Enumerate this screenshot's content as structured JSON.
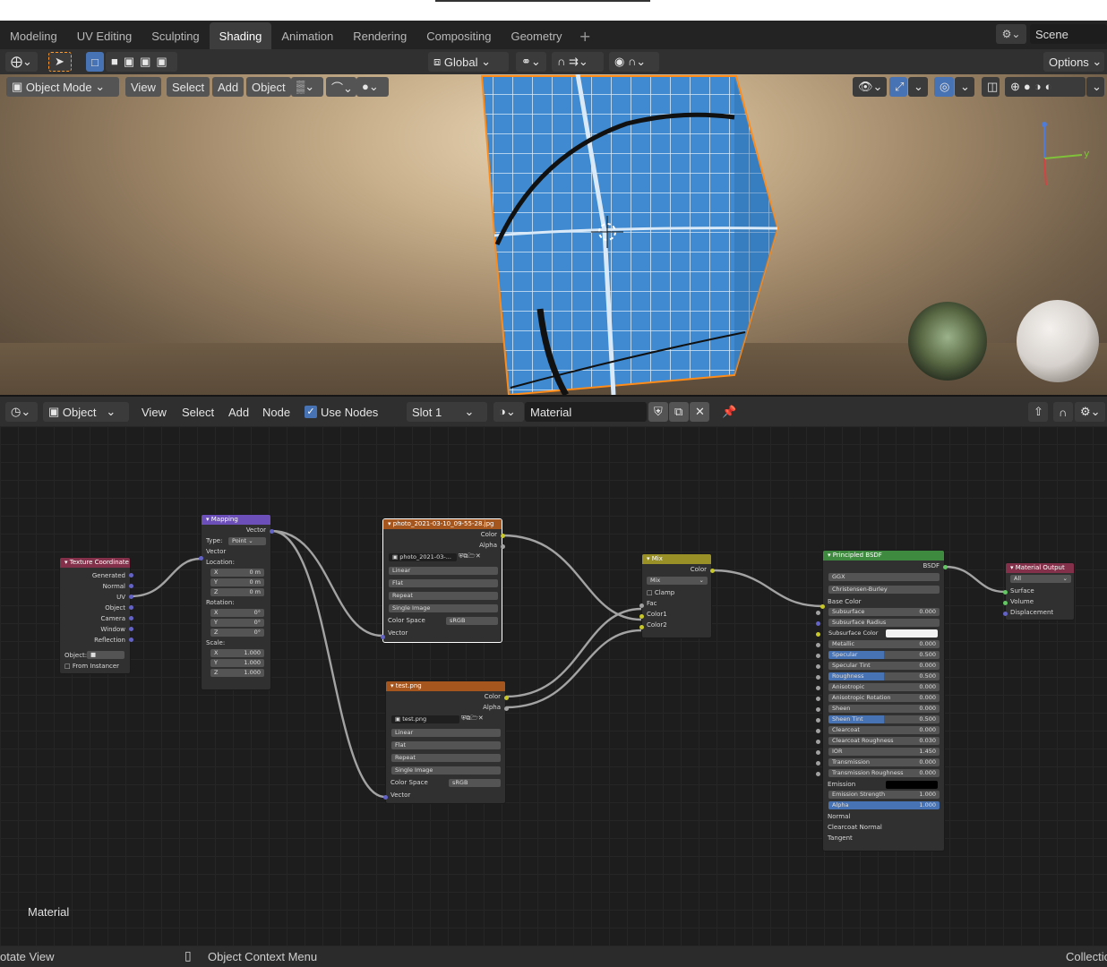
{
  "workspaces": [
    "Modeling",
    "UV Editing",
    "Sculpting",
    "Shading",
    "Animation",
    "Rendering",
    "Compositing",
    "Geometry"
  ],
  "active_workspace": "Shading",
  "scene_name": "Scene",
  "viewport": {
    "transform_orientation": "Global",
    "options": "Options",
    "mode": "Object Mode",
    "menus": [
      "View",
      "Select",
      "Add",
      "Object"
    ],
    "axis_y": "y"
  },
  "node_editor": {
    "type": "Object",
    "menus": [
      "View",
      "Select",
      "Add",
      "Node"
    ],
    "use_nodes": "Use Nodes",
    "slot": "Slot 1",
    "material": "Material",
    "label": "Material"
  },
  "nodes": {
    "texcoord": {
      "title": "Texture Coordinate",
      "outputs": [
        "Generated",
        "Normal",
        "UV",
        "Object",
        "Camera",
        "Window",
        "Reflection"
      ],
      "object_label": "Object:",
      "from_instancer": "From Instancer"
    },
    "mapping": {
      "title": "Mapping",
      "out": "Vector",
      "type_label": "Type:",
      "type": "Point",
      "vector": "Vector",
      "location": "Location:",
      "rotation": "Rotation:",
      "scale": "Scale:",
      "loc": [
        [
          "X",
          "0 m"
        ],
        [
          "Y",
          "0 m"
        ],
        [
          "Z",
          "0 m"
        ]
      ],
      "rot": [
        [
          "X",
          "0°"
        ],
        [
          "Y",
          "0°"
        ],
        [
          "Z",
          "0°"
        ]
      ],
      "scl": [
        [
          "X",
          "1.000"
        ],
        [
          "Y",
          "1.000"
        ],
        [
          "Z",
          "1.000"
        ]
      ]
    },
    "img1": {
      "title": "photo_2021-03-10_09-55-28.jpg",
      "color": "Color",
      "alpha": "Alpha",
      "file": "photo_2021-03-...",
      "interp": "Linear",
      "proj": "Flat",
      "ext": "Repeat",
      "src": "Single Image",
      "cs_label": "Color Space",
      "cs": "sRGB",
      "vector": "Vector"
    },
    "img2": {
      "title": "test.png",
      "color": "Color",
      "alpha": "Alpha",
      "file": "test.png",
      "interp": "Linear",
      "proj": "Flat",
      "ext": "Repeat",
      "src": "Single Image",
      "cs_label": "Color Space",
      "cs": "sRGB",
      "vector": "Vector"
    },
    "mix": {
      "title": "Mix",
      "color": "Color",
      "blend": "Mix",
      "clamp": "Clamp",
      "fac": "Fac",
      "c1": "Color1",
      "c2": "Color2"
    },
    "bsdf": {
      "title": "Principled BSDF",
      "out": "BSDF",
      "dist": "GGX",
      "sss": "Christensen-Burley",
      "base": "Base Color",
      "props": [
        [
          "Subsurface",
          "0.000",
          0
        ],
        [
          "Subsurface Radius",
          "",
          0
        ],
        [
          "Subsurface Color",
          "",
          0
        ],
        [
          "Metallic",
          "0.000",
          0
        ],
        [
          "Specular",
          "0.500",
          0.5
        ],
        [
          "Specular Tint",
          "0.000",
          0
        ],
        [
          "Roughness",
          "0.500",
          0.5
        ],
        [
          "Anisotropic",
          "0.000",
          0
        ],
        [
          "Anisotropic Rotation",
          "0.000",
          0
        ],
        [
          "Sheen",
          "0.000",
          0
        ],
        [
          "Sheen Tint",
          "0.500",
          0.5
        ],
        [
          "Clearcoat",
          "0.000",
          0
        ],
        [
          "Clearcoat Roughness",
          "0.030",
          0
        ],
        [
          "IOR",
          "1.450",
          0
        ],
        [
          "Transmission",
          "0.000",
          0
        ],
        [
          "Transmission Roughness",
          "0.000",
          0
        ]
      ],
      "emission": "Emission",
      "emission_strength": [
        "Emission Strength",
        "1.000"
      ],
      "alpha": [
        "Alpha",
        "1.000"
      ],
      "tail": [
        "Normal",
        "Clearcoat Normal",
        "Tangent"
      ]
    },
    "out": {
      "title": "Material Output",
      "target": "All",
      "inputs": [
        "Surface",
        "Volume",
        "Displacement"
      ]
    }
  },
  "status": {
    "left": "otate View",
    "mid": "Object Context Menu",
    "right": "Collectio"
  },
  "colors": {
    "accent": "#4772b3",
    "cube": "#3f8ad0",
    "select": "#ff8c19"
  }
}
